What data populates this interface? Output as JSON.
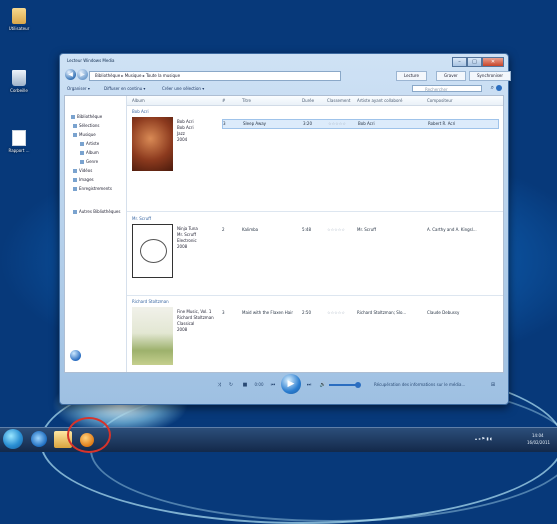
{
  "desktop": {
    "icons": [
      {
        "name": "user-folder-icon",
        "label": "Utilisateur"
      },
      {
        "name": "recycle-bin-icon",
        "label": "Corbeille"
      },
      {
        "name": "doc-icon",
        "label": "Rapport ..."
      }
    ]
  },
  "window": {
    "title": "Lecteur Windows Media",
    "address": "Bibliothèque ▸ Musique ▸ Toute la musique",
    "tabs": [
      "Lecture",
      "Graver",
      "Synchroniser"
    ],
    "commands": [
      "Organiser ▾",
      "Diffuser en continu ▾",
      "Créer une sélection ▾"
    ],
    "search_placeholder": "Rechercher",
    "controls": {
      "time": "0:00",
      "rewind": "⏮",
      "stop": "■",
      "play": "▶",
      "forward": "⏭"
    },
    "now_playing_status": "Récupération des informations sur le média..."
  },
  "nav": {
    "items": [
      "Bibliothèque",
      "Sélections",
      "Musique",
      "Artiste",
      "Album",
      "Genre",
      "Vidéos",
      "Images",
      "Enregistrements",
      "Autres Bibliothèques"
    ]
  },
  "columns": [
    "Album",
    "#",
    "Titre",
    "Durée",
    "Classement",
    "Artiste ayant collaboré",
    "Compositeur"
  ],
  "albums": [
    {
      "artist": "Bob Acri",
      "album": [
        "Bob Acri",
        "Bob Acri",
        "Jazz",
        "2004"
      ],
      "track": {
        "num": "3",
        "title": "Sleep Away",
        "dur": "3:20",
        "collab": "Bob Acri",
        "composer": "Robert R. Acri"
      }
    },
    {
      "artist": "Mr. Scruff",
      "album": [
        "Ninja Tuna",
        "Mr. Scruff",
        "Electronic",
        "2008"
      ],
      "track": {
        "num": "2",
        "title": "Kalimba",
        "dur": "5:48",
        "collab": "Mr. Scruff",
        "composer": "A. Carthy and A. Kingsl..."
      }
    },
    {
      "artist": "Richard Stoltzman",
      "album": [
        "Fine Music, Vol. 1",
        "Richard Stoltzman",
        "Classical",
        "2008"
      ],
      "track": {
        "num": "3",
        "title": "Maid with the Flaxen Hair",
        "dur": "2:50",
        "collab": "Richard Stoltzman; Slo...",
        "composer": "Claude Debussy"
      }
    }
  ],
  "taskbar": {
    "time": "14:04",
    "date": "16/02/2011"
  },
  "colors": {
    "highlight": "#d7332a",
    "accent": "#2a7dd0"
  }
}
